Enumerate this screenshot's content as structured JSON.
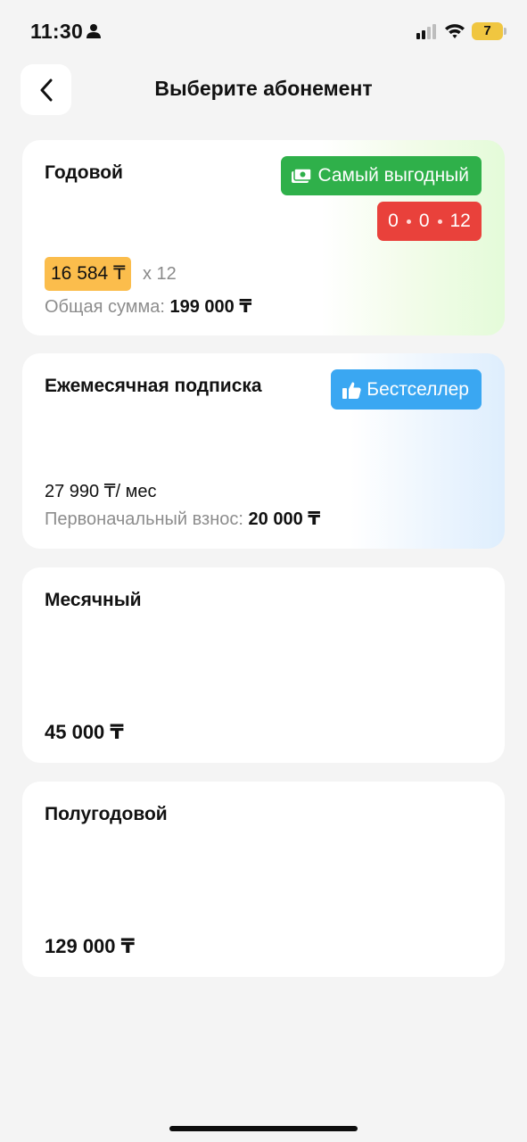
{
  "status_bar": {
    "time": "11:30",
    "battery_level": "7",
    "icons": [
      "person-icon",
      "cellular-signal-icon",
      "wifi-icon",
      "battery-icon"
    ]
  },
  "header": {
    "title": "Выберите абонемент",
    "back_icon": "chevron-left-icon"
  },
  "plans": {
    "annual": {
      "title": "Годовой",
      "badge_label": "Самый выгодный",
      "badge_icon": "money-icon",
      "badge_color": "#2fb04a",
      "timer": {
        "hours": "0",
        "minutes": "0",
        "seconds": "12"
      },
      "timer_color": "#e9413b",
      "monthly_price": "16 584 ₸",
      "multiplier": "x 12",
      "total_label": "Общая сумма:",
      "total_value": "199 000 ₸"
    },
    "installment": {
      "title": "Ежемесячная подписка",
      "badge_label": "Бестселлер",
      "badge_icon": "thumbs-up-icon",
      "badge_color": "#3aa7f2",
      "price": "27 990 ₸/ мес",
      "down_payment_label": "Первоначальный взнос:",
      "down_payment_value": "20 000 ₸"
    },
    "monthly": {
      "title": "Месячный",
      "price": "45 000 ₸"
    },
    "half_year": {
      "title": "Полугодовой",
      "price": "129 000 ₸"
    }
  }
}
